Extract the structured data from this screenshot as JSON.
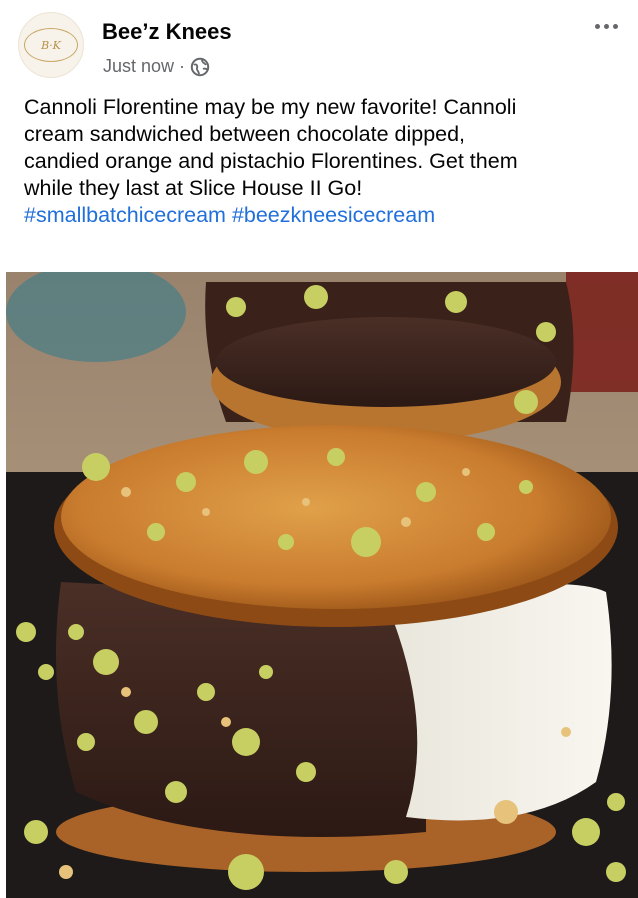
{
  "post": {
    "page_name": "Bee’z Knees",
    "timestamp": "Just now",
    "separator": "·",
    "privacy_icon": "globe-icon",
    "more_icon": "more-options-icon",
    "avatar_logo_text": "Bee’z Knees",
    "caption_lines": [
      "Cannoli Florentine may be my new favorite!  Cannoli",
      "cream sandwiched between chocolate dipped,",
      "candied orange and pistachio Florentines.  Get them",
      "while they last at Slice House II Go!"
    ],
    "hashtags": [
      "#smallbatchicecream",
      "#beezkneesicecream"
    ]
  },
  "colors": {
    "name_text": "#050505",
    "meta_text": "#65676b",
    "hashtag": "#216fdb"
  }
}
